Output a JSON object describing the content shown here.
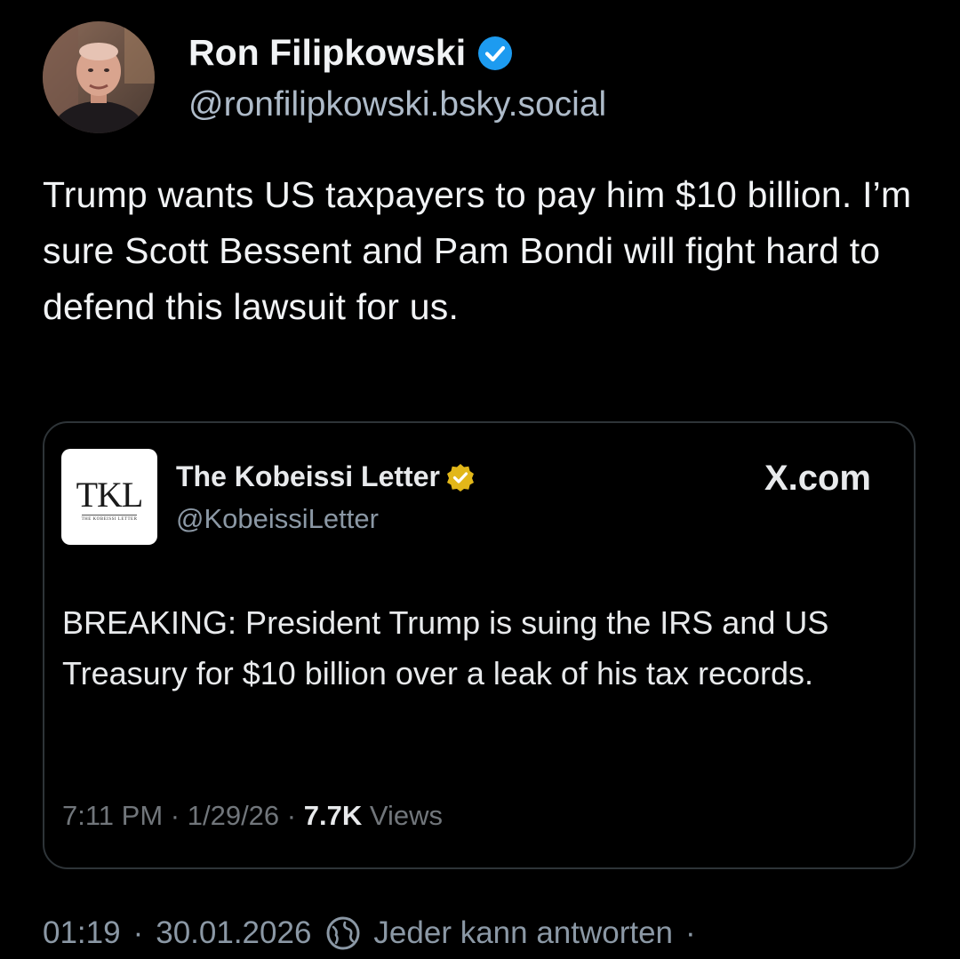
{
  "post": {
    "author": {
      "display_name": "Ron Filipkowski",
      "handle": "@ronfilipkowski.bsky.social",
      "verified": true
    },
    "text": "Trump wants US taxpayers to pay him $10 billion. I’m sure Scott Bessent and Pam Bondi will fight hard to defend this lawsuit for us.",
    "embed": {
      "logo": {
        "main_text": "TKL",
        "sub_text": "THE KOBEISSI LETTER"
      },
      "account_name": "The Kobeissi Letter",
      "account_handle": "@KobeissiLetter",
      "source": "X.com",
      "text": "BREAKING: President Trump is suing the IRS and US Treasury for $10 billion over a leak of his tax records.",
      "meta": {
        "time": "7:11 PM",
        "date": "1/29/26",
        "views_count": "7.7K",
        "views_label": "Views",
        "separator": "·"
      }
    },
    "footer": {
      "time": "01:19",
      "date": "30.01.2026",
      "separator": "·",
      "reply_setting": "Jeder kann antworten",
      "trailing": "·"
    }
  },
  "colors": {
    "background": "#000000",
    "primary_text": "#f1f3f5",
    "secondary_text": "#8b98a5",
    "verified_blue": "#1d9bf0",
    "verified_gold": "#e2b719",
    "card_border": "#2e3438"
  },
  "icons": {
    "verified": "verified-check-icon",
    "gold_verified": "gold-verified-badge-icon",
    "reply_setting": "globe-reply-icon"
  }
}
